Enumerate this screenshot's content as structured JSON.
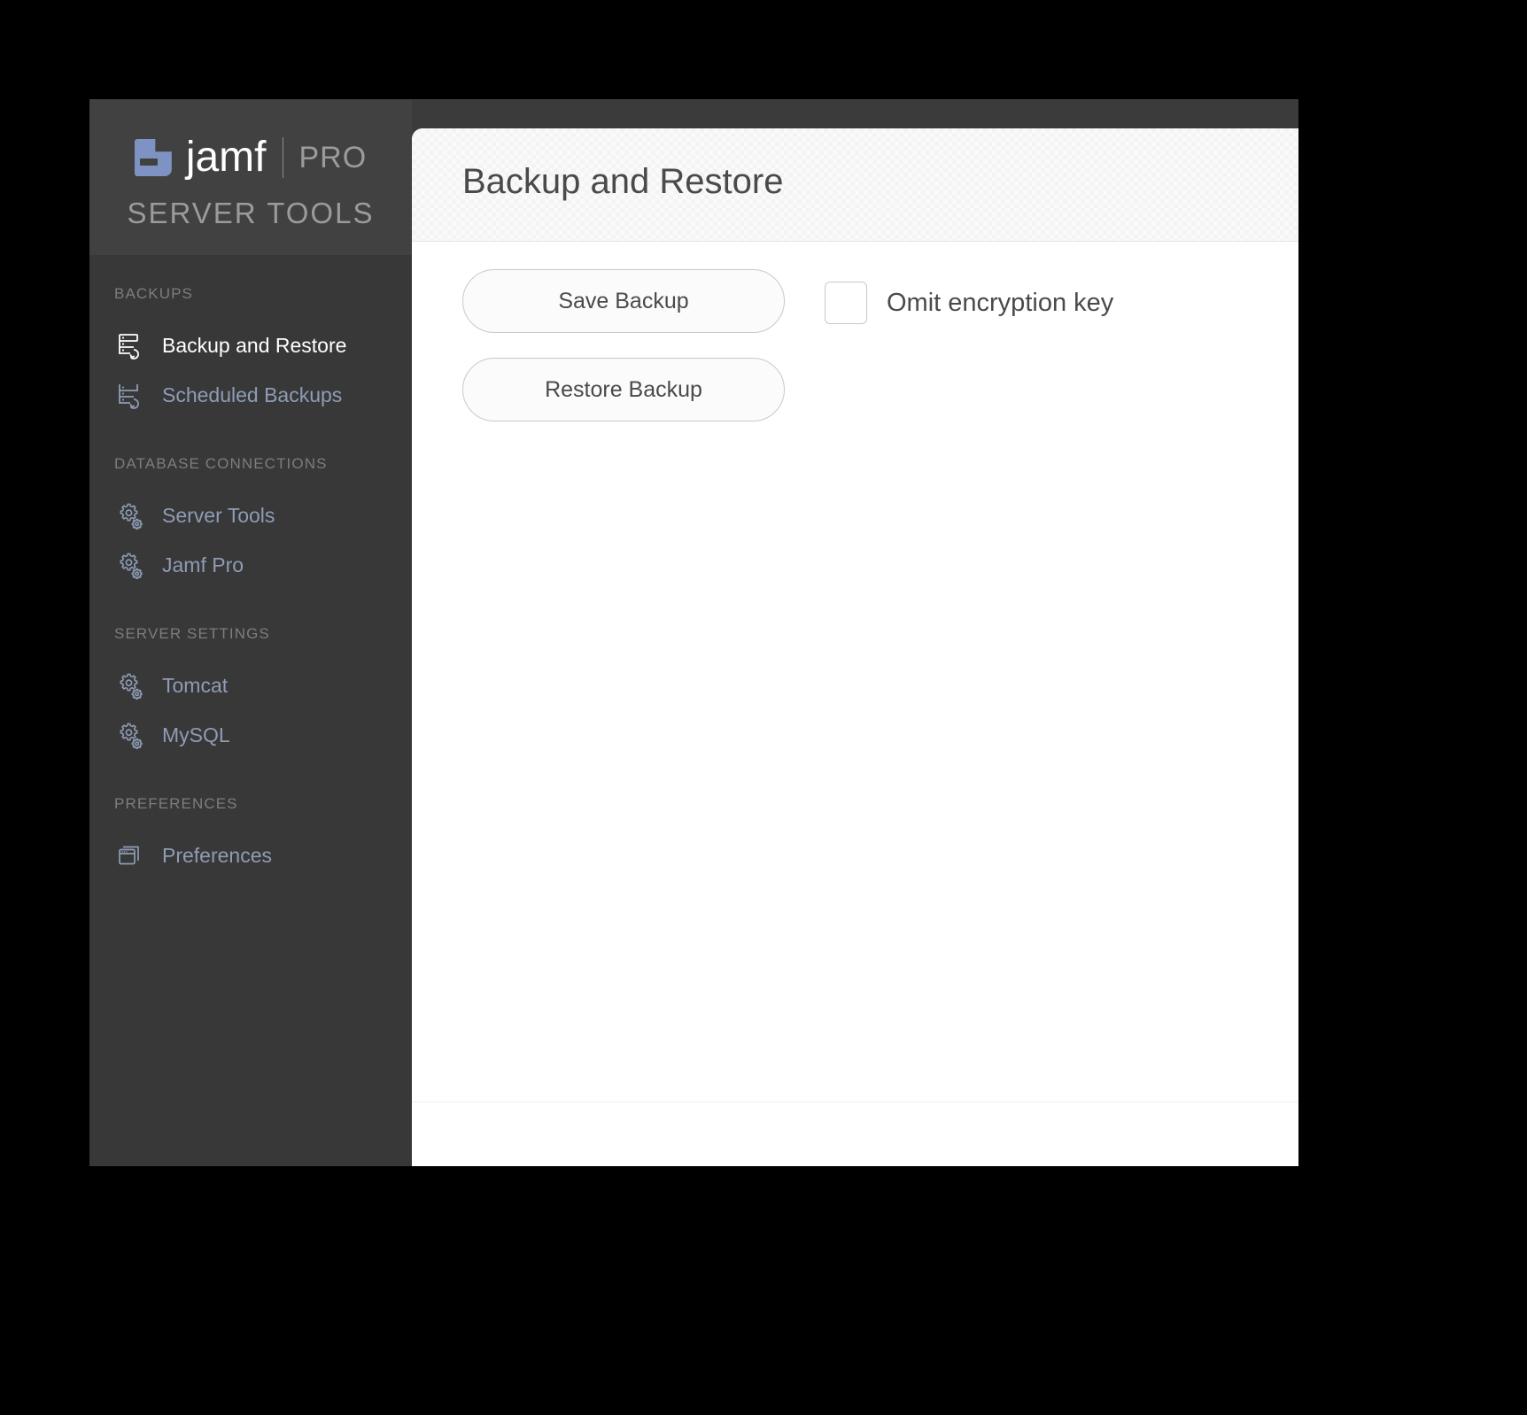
{
  "app": {
    "brand": {
      "logo_icon": "jamf-logo-mark",
      "name": "jamf",
      "edition": "PRO",
      "subtitle": "SERVER TOOLS"
    }
  },
  "sidebar": {
    "sections": [
      {
        "title": "BACKUPS",
        "items": [
          {
            "label": "Backup and Restore",
            "icon": "server-restore-icon",
            "active": true
          },
          {
            "label": "Scheduled Backups",
            "icon": "server-schedule-icon",
            "active": false
          }
        ]
      },
      {
        "title": "DATABASE CONNECTIONS",
        "items": [
          {
            "label": "Server Tools",
            "icon": "gears-icon",
            "active": false
          },
          {
            "label": "Jamf Pro",
            "icon": "gears-icon",
            "active": false
          }
        ]
      },
      {
        "title": "SERVER SETTINGS",
        "items": [
          {
            "label": "Tomcat",
            "icon": "gears-icon",
            "active": false
          },
          {
            "label": "MySQL",
            "icon": "gears-icon",
            "active": false
          }
        ]
      },
      {
        "title": "PREFERENCES",
        "items": [
          {
            "label": "Preferences",
            "icon": "windows-stack-icon",
            "active": false
          }
        ]
      }
    ]
  },
  "main": {
    "title": "Backup and Restore",
    "save_backup_label": "Save Backup",
    "restore_backup_label": "Restore Backup",
    "omit_encryption_key_label": "Omit encryption key",
    "omit_encryption_key_checked": false
  },
  "colors": {
    "sidebar_bg": "#383838",
    "sidebar_brand_bg": "#414141",
    "window_chrome": "#3b3b3b",
    "nav_label": "#8e9cb5",
    "nav_label_active": "#ffffff",
    "nav_section_title": "#7d7d7d",
    "brand_accent": "#7e93c4",
    "content_bg": "#ffffff",
    "header_bg": "#fafafa",
    "button_border": "#c6c9d2",
    "text_primary": "#4a4a4a"
  }
}
